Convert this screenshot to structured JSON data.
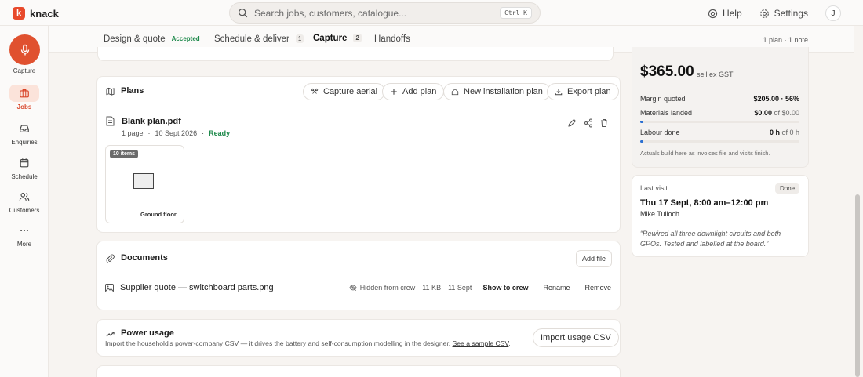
{
  "app": {
    "logo_letter": "k",
    "name": "knack"
  },
  "search": {
    "placeholder": "Search jobs, customers, catalogue...",
    "shortcut": "Ctrl K"
  },
  "topbar": {
    "help": "Help",
    "settings": "Settings",
    "avatar": "J"
  },
  "sidebar": {
    "capture_label": "Capture",
    "items": [
      {
        "label": "Jobs",
        "icon": "briefcase-icon",
        "active": true
      },
      {
        "label": "Enquiries",
        "icon": "inbox-icon",
        "active": false
      },
      {
        "label": "Schedule",
        "icon": "calendar-icon",
        "active": false
      },
      {
        "label": "Customers",
        "icon": "users-icon",
        "active": false
      },
      {
        "label": "More",
        "icon": "more-icon",
        "active": false
      }
    ]
  },
  "tabs": [
    {
      "label": "Design & quote",
      "badge": "Accepted"
    },
    {
      "label": "Schedule & deliver",
      "count": "1"
    },
    {
      "label": "Capture",
      "count": "2",
      "active": true
    },
    {
      "label": "Handoffs"
    }
  ],
  "tab_summary": "1 plan · 1 note",
  "plans": {
    "title": "Plans",
    "buttons": {
      "capture_aerial": "Capture aerial",
      "add_plan": "Add plan",
      "new_installation_plan": "New installation plan",
      "export_plan": "Export plan"
    },
    "file": {
      "name": "Blank plan.pdf",
      "pages": "1 page",
      "date": "10 Sept 2026",
      "status": "Ready",
      "sep": "·"
    },
    "thumb": {
      "badge": "10 items",
      "label": "Ground floor"
    }
  },
  "documents": {
    "title": "Documents",
    "add_file": "Add file",
    "row": {
      "name": "Supplier quote — switchboard parts.png",
      "visibility": "Hidden from crew",
      "size": "11 KB",
      "date": "11 Sept",
      "show": "Show to crew",
      "rename": "Rename",
      "remove": "Remove"
    }
  },
  "power": {
    "title": "Power usage",
    "desc": "Import the household's power-company CSV — it drives the battery and self-consumption modelling in the designer.",
    "link": "See a sample CSV",
    "period": ".",
    "button": "Import usage CSV"
  },
  "summary": {
    "price": "$365.00",
    "price_sub": "sell ex GST",
    "margin_label": "Margin quoted",
    "margin_value": "$205.00 · 56%",
    "materials_label": "Materials landed",
    "materials_value": "$0.00",
    "materials_of": "of $0.00",
    "materials_progress": 0.02,
    "labour_label": "Labour done",
    "labour_value": "0 h",
    "labour_of": "of 0 h",
    "labour_progress": 0.02,
    "note": "Actuals build here as invoices file and visits finish."
  },
  "visit": {
    "label": "Last visit",
    "badge": "Done",
    "when": "Thu 17 Sept, 8:00 am–12:00 pm",
    "who": "Mike Tulloch",
    "quote": "“Rewired all three downlight circuits and both GPOs. Tested and labelled at the board.”"
  }
}
